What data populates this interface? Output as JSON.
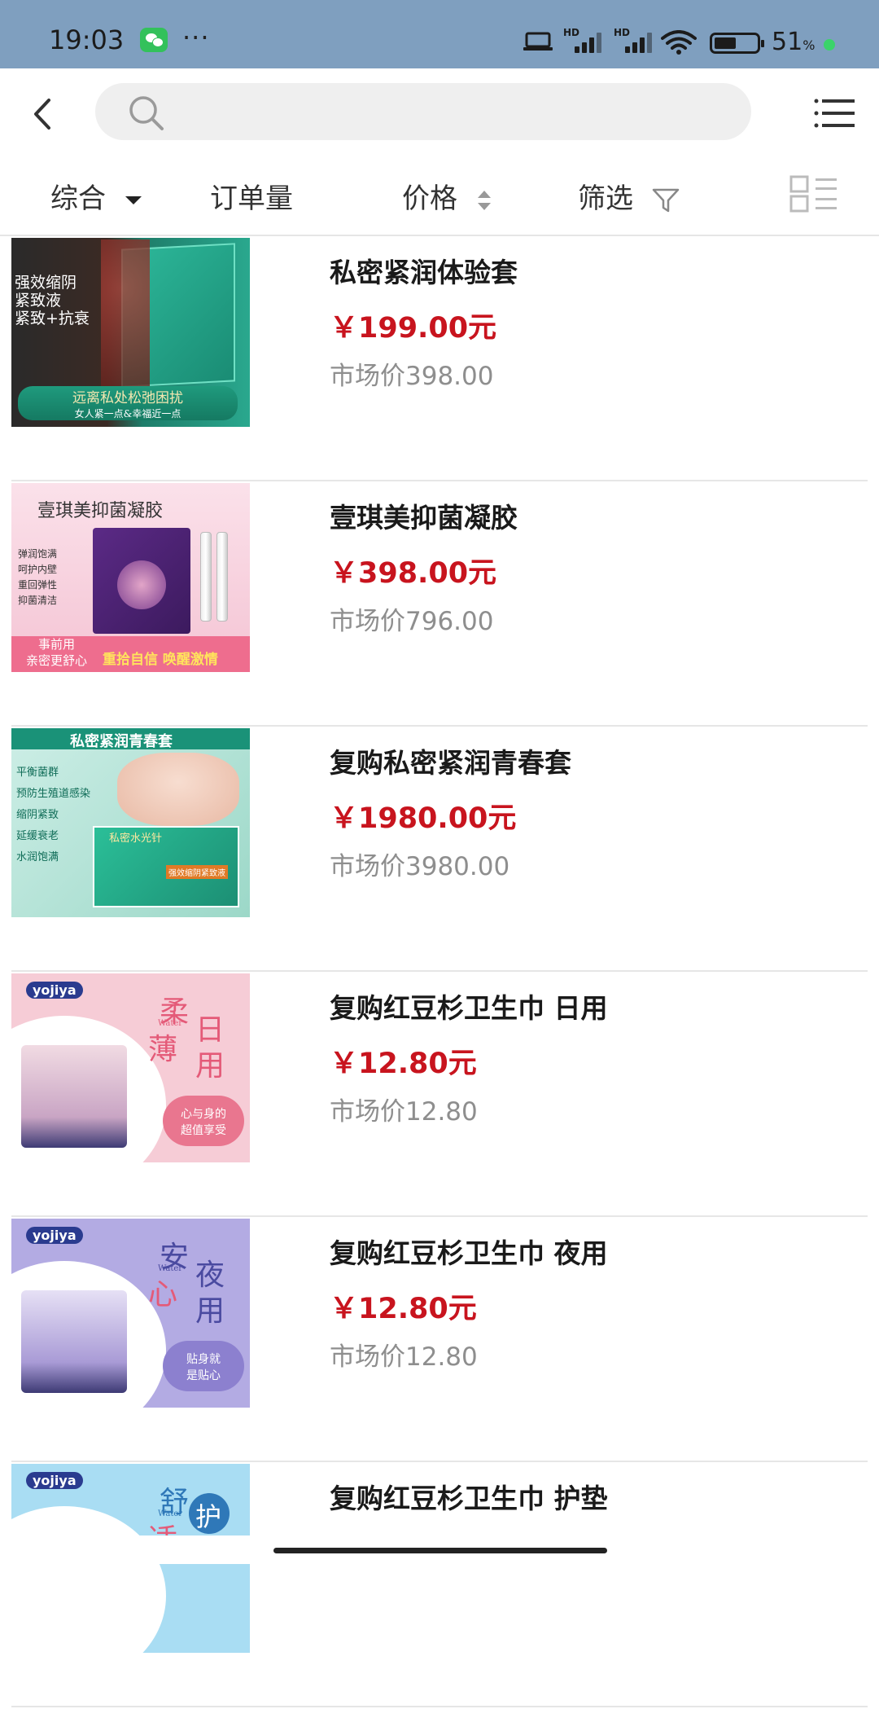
{
  "status_bar": {
    "time": "19:03",
    "more": "···",
    "battery_percent": "51",
    "battery_unit": "%",
    "battery_level": 0.51,
    "hd_label": "HD",
    "icons": [
      "wechat-icon",
      "laptop-icon",
      "hd-signal-icon",
      "wifi-icon",
      "battery-icon"
    ]
  },
  "header": {
    "search_placeholder": "",
    "icons": [
      "back-icon",
      "search-icon",
      "menu-icon"
    ]
  },
  "filters": {
    "items": [
      {
        "label": "综合",
        "icon": "caret-down-icon"
      },
      {
        "label": "订单量"
      },
      {
        "label": "价格",
        "icon": "sort-icon"
      },
      {
        "label": "筛选",
        "icon": "filter-icon"
      }
    ],
    "layout_toggle_icon": "list-layout-icon"
  },
  "colors": {
    "status_bar": "#7f9fbf",
    "price": "#c8141e",
    "market_price": "#8e8e8e",
    "search_bg": "#efefef"
  },
  "products": [
    {
      "title": "私密紧润体验套",
      "price": "￥199.00元",
      "market_price": "市场价398.00",
      "thumb": {
        "lines": [
          "强效缩阴",
          "紧致液",
          "紧致+抗衰"
        ],
        "banner": "远离私处松弛困扰",
        "sub": "女人紧一点&幸福近一点"
      }
    },
    {
      "title": "壹琪美抑菌凝胶",
      "price": "￥398.00元",
      "market_price": "市场价796.00",
      "thumb": {
        "heading": "壹琪美抑菌凝胶",
        "bullets": [
          "弹润饱满",
          "呵护内壁",
          "重回弹性",
          "抑菌清洁"
        ],
        "tag": "事前用",
        "tag2": "亲密更舒心",
        "slogan": "重拾自信 唤醒激情"
      }
    },
    {
      "title": "复购私密紧润青春套",
      "price": "￥1980.00元",
      "market_price": "市场价3980.00",
      "thumb": {
        "heading": "私密紧润青春套",
        "bullets": [
          "平衡菌群",
          "预防生殖道感染",
          "缩阴紧致",
          "延缓衰老",
          "水润饱满"
        ],
        "box": "私密水光针",
        "box2": "强效缩阴紧致液"
      }
    },
    {
      "title": "复购红豆杉卫生巾 日用",
      "price": "￥12.80元",
      "market_price": "市场价12.80",
      "thumb": {
        "brand": "yojiya",
        "big1": "柔",
        "big2": "薄",
        "big3": "日",
        "big4": "用",
        "water": "Water",
        "badge": "心与身的",
        "badge2": "超值享受"
      }
    },
    {
      "title": "复购红豆杉卫生巾 夜用",
      "price": "￥12.80元",
      "market_price": "市场价12.80",
      "thumb": {
        "brand": "yojiya",
        "big1": "安",
        "big2": "心",
        "big3": "夜",
        "big4": "用",
        "water": "Water",
        "badge": "贴身就",
        "badge2": "是贴心"
      }
    },
    {
      "title": "复购红豆杉卫生巾 护垫",
      "price": "",
      "market_price": "",
      "thumb": {
        "brand": "yojiya",
        "big1": "舒",
        "big2": "适",
        "big3": "护",
        "water": "Water"
      }
    }
  ]
}
